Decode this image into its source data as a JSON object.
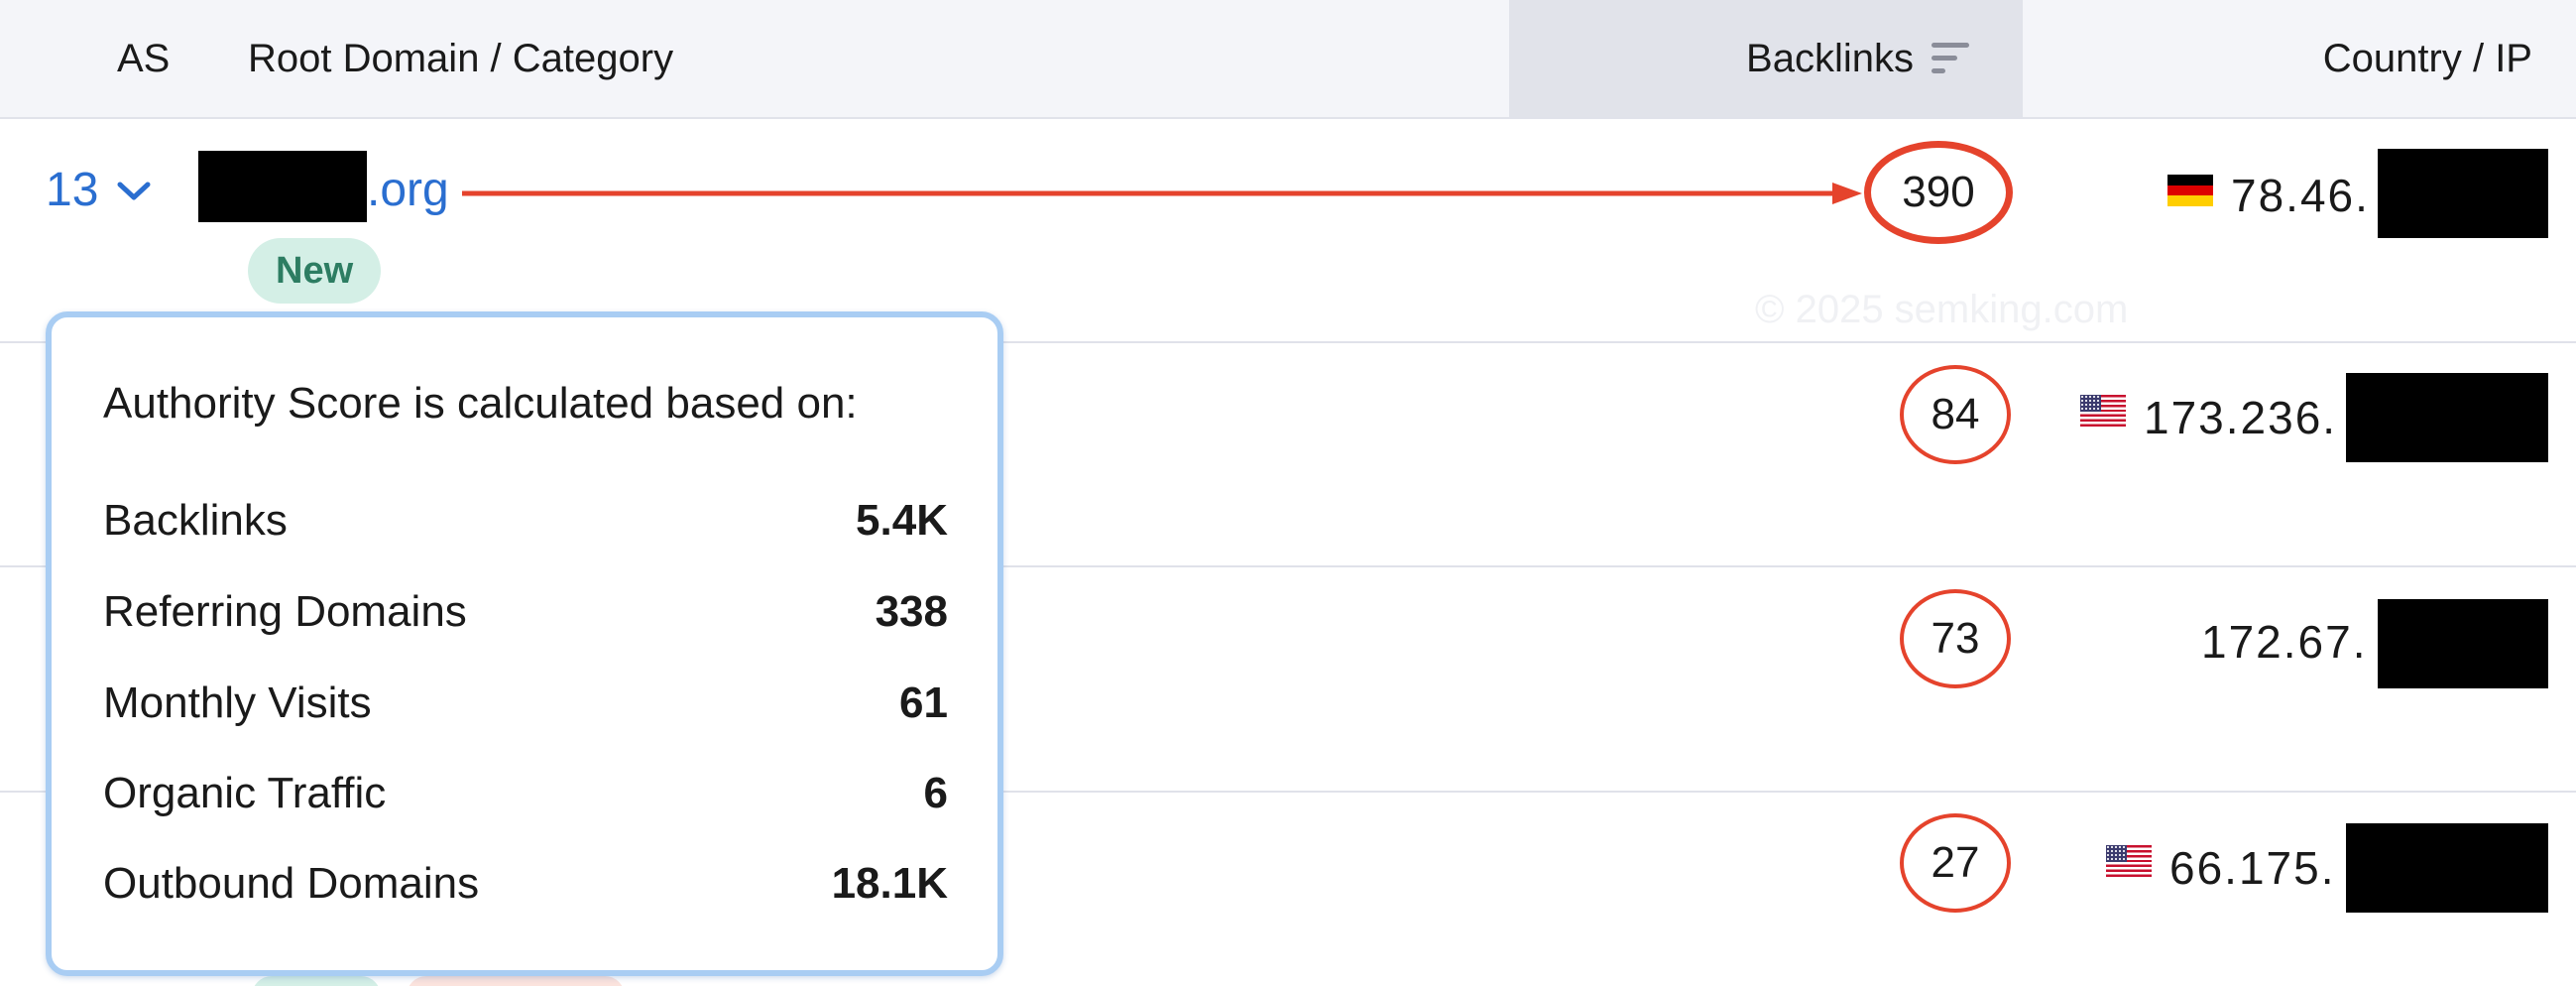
{
  "header": {
    "as_label": "AS",
    "root_label": "Root Domain / Category",
    "backlinks_label": "Backlinks",
    "country_label": "Country / IP",
    "sort_icon": "sort-icon"
  },
  "rows": [
    {
      "as_score": "13",
      "domain_tld": ".org",
      "badge": "New",
      "backlinks": "390",
      "ip_prefix": "78.46.",
      "flag": "de"
    },
    {
      "backlinks": "84",
      "ip_prefix": "173.236.",
      "flag": "us"
    },
    {
      "backlinks": "73",
      "ip_prefix": "172.67.",
      "flag": ""
    },
    {
      "backlinks": "27",
      "ip_prefix": "66.175.",
      "flag": "us"
    }
  ],
  "watermark": "© 2025 semking.com",
  "popover": {
    "title": "Authority Score is calculated based on:",
    "items": [
      {
        "label": "Backlinks",
        "value": "5.4K"
      },
      {
        "label": "Referring Domains",
        "value": "338"
      },
      {
        "label": "Monthly Visits",
        "value": "61"
      },
      {
        "label": "Organic Traffic",
        "value": "6"
      },
      {
        "label": "Outbound Domains",
        "value": "18.1K"
      }
    ]
  },
  "colors": {
    "link_blue": "#2a6ed0",
    "annotation_red": "#e5432c",
    "badge_green_bg": "#d4efe6",
    "badge_green_text": "#2d7d62",
    "popover_border": "#a9cdf3"
  }
}
